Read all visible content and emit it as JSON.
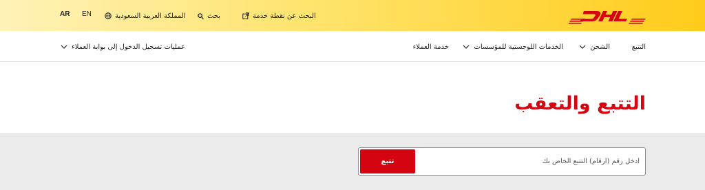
{
  "brand": {
    "name": "DHL",
    "red": "#d40511",
    "yellow": "#ffcc00"
  },
  "topbar": {
    "service_point": {
      "label": "البحث عن نقطة خدمة",
      "icon": "external-link-icon"
    },
    "search": {
      "label": "بحث",
      "icon": "search-icon"
    },
    "country": {
      "label": "المملكة العربية السعودية",
      "icon": "globe-icon"
    },
    "languages": [
      "EN",
      "AR"
    ],
    "active_language": "AR"
  },
  "nav": {
    "items": [
      {
        "label": "التتبع",
        "dropdown": false
      },
      {
        "label": "الشحن",
        "dropdown": true
      },
      {
        "label": "الخدمات اللوجستية للمؤسسات",
        "dropdown": true
      },
      {
        "label": "خدمة العملاء",
        "dropdown": false
      }
    ],
    "portal_logins": {
      "label": "عمليات تسجيل الدخول إلى بوابة العملاء",
      "dropdown": true
    }
  },
  "page": {
    "title": "التتبع والتعقب"
  },
  "tracking": {
    "placeholder": "أدخل رقم (أرقام) التتبع الخاص بك",
    "value": "",
    "button_label": "تتبع"
  }
}
